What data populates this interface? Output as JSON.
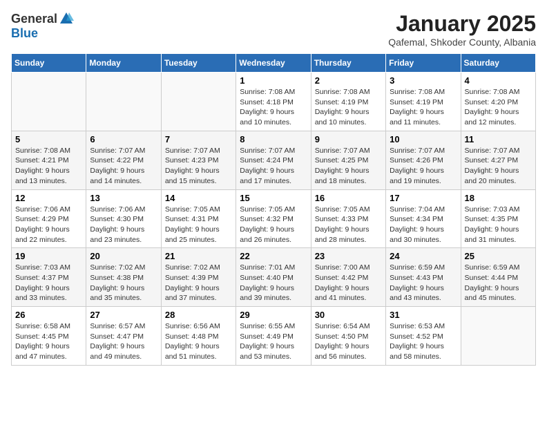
{
  "logo": {
    "general": "General",
    "blue": "Blue"
  },
  "title": "January 2025",
  "subtitle": "Qafemal, Shkoder County, Albania",
  "days_of_week": [
    "Sunday",
    "Monday",
    "Tuesday",
    "Wednesday",
    "Thursday",
    "Friday",
    "Saturday"
  ],
  "weeks": [
    [
      {
        "day": "",
        "info": ""
      },
      {
        "day": "",
        "info": ""
      },
      {
        "day": "",
        "info": ""
      },
      {
        "day": "1",
        "info": "Sunrise: 7:08 AM\nSunset: 4:18 PM\nDaylight: 9 hours and 10 minutes."
      },
      {
        "day": "2",
        "info": "Sunrise: 7:08 AM\nSunset: 4:19 PM\nDaylight: 9 hours and 10 minutes."
      },
      {
        "day": "3",
        "info": "Sunrise: 7:08 AM\nSunset: 4:19 PM\nDaylight: 9 hours and 11 minutes."
      },
      {
        "day": "4",
        "info": "Sunrise: 7:08 AM\nSunset: 4:20 PM\nDaylight: 9 hours and 12 minutes."
      }
    ],
    [
      {
        "day": "5",
        "info": "Sunrise: 7:08 AM\nSunset: 4:21 PM\nDaylight: 9 hours and 13 minutes."
      },
      {
        "day": "6",
        "info": "Sunrise: 7:07 AM\nSunset: 4:22 PM\nDaylight: 9 hours and 14 minutes."
      },
      {
        "day": "7",
        "info": "Sunrise: 7:07 AM\nSunset: 4:23 PM\nDaylight: 9 hours and 15 minutes."
      },
      {
        "day": "8",
        "info": "Sunrise: 7:07 AM\nSunset: 4:24 PM\nDaylight: 9 hours and 17 minutes."
      },
      {
        "day": "9",
        "info": "Sunrise: 7:07 AM\nSunset: 4:25 PM\nDaylight: 9 hours and 18 minutes."
      },
      {
        "day": "10",
        "info": "Sunrise: 7:07 AM\nSunset: 4:26 PM\nDaylight: 9 hours and 19 minutes."
      },
      {
        "day": "11",
        "info": "Sunrise: 7:07 AM\nSunset: 4:27 PM\nDaylight: 9 hours and 20 minutes."
      }
    ],
    [
      {
        "day": "12",
        "info": "Sunrise: 7:06 AM\nSunset: 4:29 PM\nDaylight: 9 hours and 22 minutes."
      },
      {
        "day": "13",
        "info": "Sunrise: 7:06 AM\nSunset: 4:30 PM\nDaylight: 9 hours and 23 minutes."
      },
      {
        "day": "14",
        "info": "Sunrise: 7:05 AM\nSunset: 4:31 PM\nDaylight: 9 hours and 25 minutes."
      },
      {
        "day": "15",
        "info": "Sunrise: 7:05 AM\nSunset: 4:32 PM\nDaylight: 9 hours and 26 minutes."
      },
      {
        "day": "16",
        "info": "Sunrise: 7:05 AM\nSunset: 4:33 PM\nDaylight: 9 hours and 28 minutes."
      },
      {
        "day": "17",
        "info": "Sunrise: 7:04 AM\nSunset: 4:34 PM\nDaylight: 9 hours and 30 minutes."
      },
      {
        "day": "18",
        "info": "Sunrise: 7:03 AM\nSunset: 4:35 PM\nDaylight: 9 hours and 31 minutes."
      }
    ],
    [
      {
        "day": "19",
        "info": "Sunrise: 7:03 AM\nSunset: 4:37 PM\nDaylight: 9 hours and 33 minutes."
      },
      {
        "day": "20",
        "info": "Sunrise: 7:02 AM\nSunset: 4:38 PM\nDaylight: 9 hours and 35 minutes."
      },
      {
        "day": "21",
        "info": "Sunrise: 7:02 AM\nSunset: 4:39 PM\nDaylight: 9 hours and 37 minutes."
      },
      {
        "day": "22",
        "info": "Sunrise: 7:01 AM\nSunset: 4:40 PM\nDaylight: 9 hours and 39 minutes."
      },
      {
        "day": "23",
        "info": "Sunrise: 7:00 AM\nSunset: 4:42 PM\nDaylight: 9 hours and 41 minutes."
      },
      {
        "day": "24",
        "info": "Sunrise: 6:59 AM\nSunset: 4:43 PM\nDaylight: 9 hours and 43 minutes."
      },
      {
        "day": "25",
        "info": "Sunrise: 6:59 AM\nSunset: 4:44 PM\nDaylight: 9 hours and 45 minutes."
      }
    ],
    [
      {
        "day": "26",
        "info": "Sunrise: 6:58 AM\nSunset: 4:45 PM\nDaylight: 9 hours and 47 minutes."
      },
      {
        "day": "27",
        "info": "Sunrise: 6:57 AM\nSunset: 4:47 PM\nDaylight: 9 hours and 49 minutes."
      },
      {
        "day": "28",
        "info": "Sunrise: 6:56 AM\nSunset: 4:48 PM\nDaylight: 9 hours and 51 minutes."
      },
      {
        "day": "29",
        "info": "Sunrise: 6:55 AM\nSunset: 4:49 PM\nDaylight: 9 hours and 53 minutes."
      },
      {
        "day": "30",
        "info": "Sunrise: 6:54 AM\nSunset: 4:50 PM\nDaylight: 9 hours and 56 minutes."
      },
      {
        "day": "31",
        "info": "Sunrise: 6:53 AM\nSunset: 4:52 PM\nDaylight: 9 hours and 58 minutes."
      },
      {
        "day": "",
        "info": ""
      }
    ]
  ]
}
